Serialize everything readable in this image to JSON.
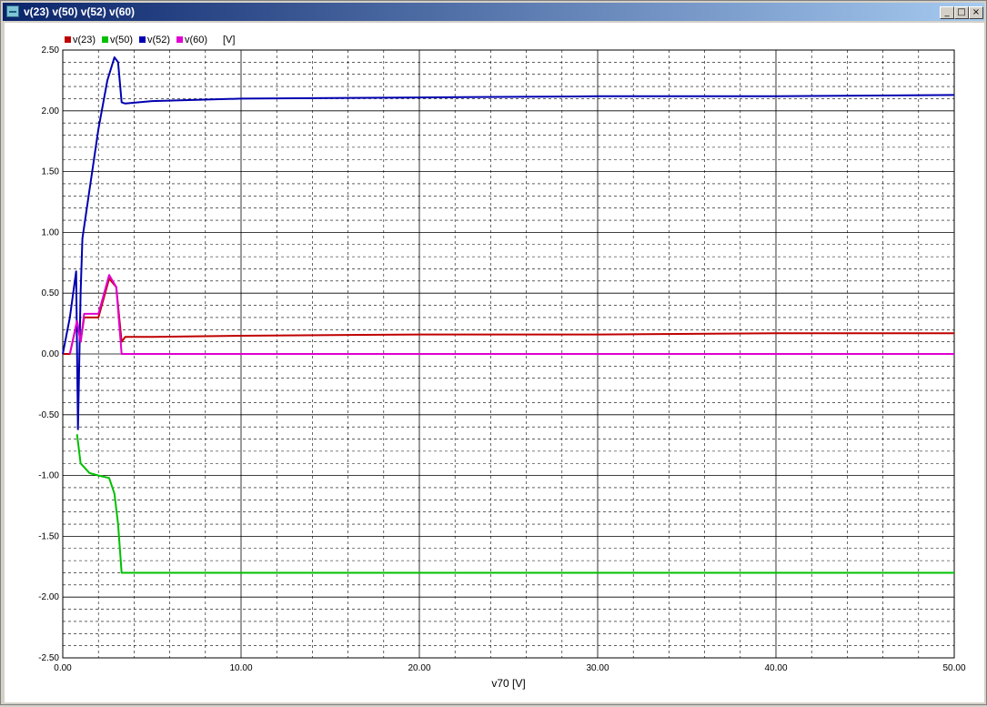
{
  "window": {
    "title": "v(23) v(50) v(52) v(60)",
    "buttons": {
      "minimize": "_",
      "maximize": "□",
      "close": "×"
    }
  },
  "chart_data": {
    "type": "line",
    "xlabel": "v70 [V]",
    "ylabel": "",
    "unit_label": "[V]",
    "xlim": [
      0,
      50
    ],
    "ylim": [
      -2.5,
      2.5
    ],
    "x_ticks": [
      "0.00",
      "10.00",
      "20.00",
      "30.00",
      "40.00",
      "50.00"
    ],
    "y_ticks": [
      "2.50",
      "2.00",
      "1.50",
      "1.00",
      "0.50",
      "0.00",
      "-0.50",
      "-1.00",
      "-1.50",
      "-2.00",
      "-2.50"
    ],
    "grid": true,
    "legend_position": "top-left",
    "series": [
      {
        "name": "v(23)",
        "color": "#c00000",
        "points": [
          [
            0,
            0.0
          ],
          [
            0.4,
            0.0
          ],
          [
            0.8,
            0.27
          ],
          [
            1.0,
            0.1
          ],
          [
            1.2,
            0.3
          ],
          [
            2.0,
            0.3
          ],
          [
            2.6,
            0.62
          ],
          [
            3.0,
            0.55
          ],
          [
            3.3,
            0.1
          ],
          [
            3.5,
            0.14
          ],
          [
            5,
            0.14
          ],
          [
            10,
            0.15
          ],
          [
            20,
            0.16
          ],
          [
            30,
            0.16
          ],
          [
            40,
            0.17
          ],
          [
            50,
            0.17
          ]
        ]
      },
      {
        "name": "v(50)",
        "color": "#00c000",
        "points": [
          [
            0.8,
            -0.66
          ],
          [
            1.0,
            -0.9
          ],
          [
            1.5,
            -0.98
          ],
          [
            2.0,
            -1.0
          ],
          [
            2.6,
            -1.02
          ],
          [
            2.9,
            -1.15
          ],
          [
            3.1,
            -1.4
          ],
          [
            3.3,
            -1.8
          ],
          [
            10,
            -1.8
          ],
          [
            20,
            -1.8
          ],
          [
            30,
            -1.8
          ],
          [
            40,
            -1.8
          ],
          [
            50,
            -1.8
          ]
        ]
      },
      {
        "name": "v(52)",
        "color": "#0000b0",
        "points": [
          [
            0,
            0.0
          ],
          [
            0.4,
            0.3
          ],
          [
            0.75,
            0.68
          ],
          [
            0.85,
            -0.62
          ],
          [
            1.0,
            0.5
          ],
          [
            1.1,
            0.95
          ],
          [
            1.5,
            1.35
          ],
          [
            2.0,
            1.85
          ],
          [
            2.5,
            2.25
          ],
          [
            2.9,
            2.44
          ],
          [
            3.1,
            2.4
          ],
          [
            3.3,
            2.07
          ],
          [
            3.5,
            2.06
          ],
          [
            5,
            2.08
          ],
          [
            10,
            2.1
          ],
          [
            20,
            2.11
          ],
          [
            30,
            2.12
          ],
          [
            40,
            2.12
          ],
          [
            50,
            2.13
          ]
        ]
      },
      {
        "name": "v(60)",
        "color": "#e000d0",
        "points": [
          [
            0.4,
            0.0
          ],
          [
            0.8,
            0.27
          ],
          [
            1.0,
            0.1
          ],
          [
            1.2,
            0.33
          ],
          [
            2.0,
            0.33
          ],
          [
            2.6,
            0.65
          ],
          [
            3.0,
            0.55
          ],
          [
            3.3,
            0.0
          ],
          [
            10,
            0.0
          ],
          [
            20,
            0.0
          ],
          [
            30,
            0.0
          ],
          [
            40,
            0.0
          ],
          [
            50,
            0.0
          ]
        ]
      }
    ]
  }
}
